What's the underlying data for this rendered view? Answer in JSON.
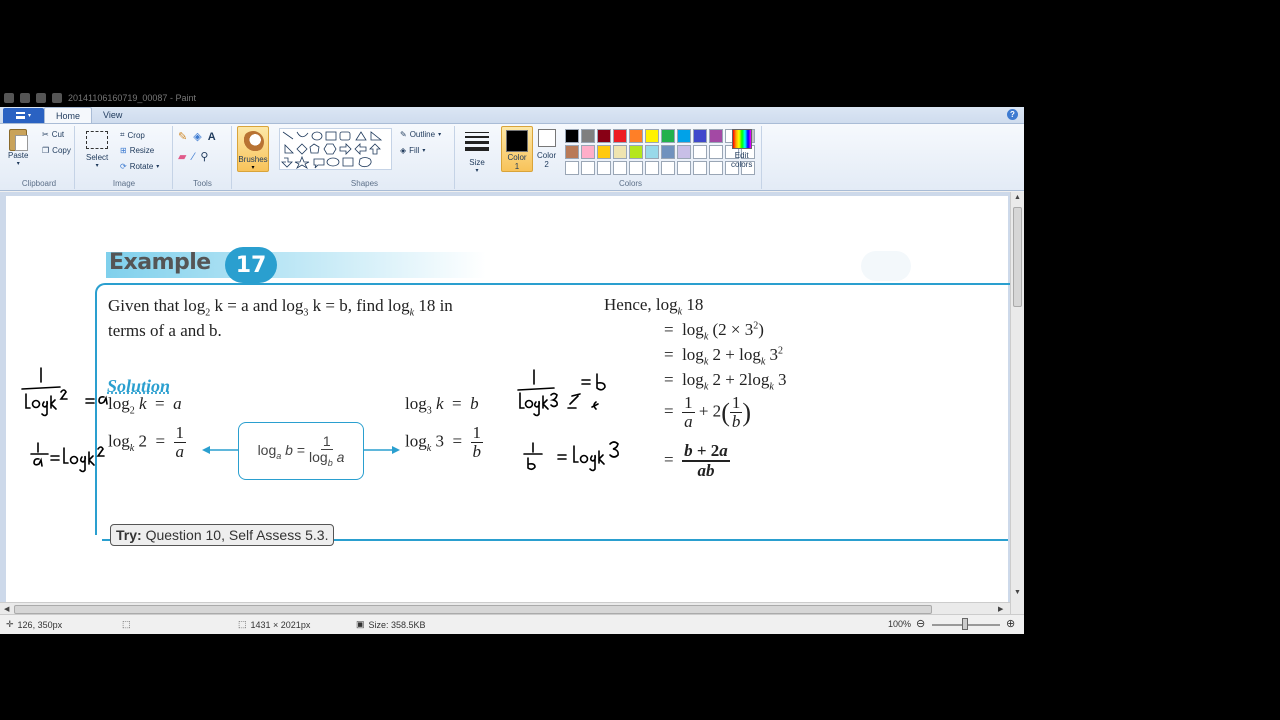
{
  "window": {
    "title": "20141106160719_00087 - Paint"
  },
  "tabs": [
    "Home",
    "View"
  ],
  "ribbon": {
    "clipboard": {
      "paste": "Paste",
      "cut": "Cut",
      "copy": "Copy",
      "label": "Clipboard"
    },
    "image": {
      "select": "Select",
      "crop": "Crop",
      "resize": "Resize",
      "rotate": "Rotate",
      "label": "Image"
    },
    "tools": {
      "label": "Tools"
    },
    "brushes": "Brushes",
    "shapes": {
      "outline": "Outline",
      "fill": "Fill",
      "label": "Shapes"
    },
    "size": "Size",
    "color1": {
      "line1": "Color",
      "line2": "1"
    },
    "color2": {
      "line1": "Color",
      "line2": "2"
    },
    "colors_label": "Colors",
    "edit_colors": {
      "line1": "Edit",
      "line2": "colors"
    },
    "palette": [
      "#000000",
      "#7f7f7f",
      "#880015",
      "#ed1c24",
      "#ff7f27",
      "#fff200",
      "#22b14c",
      "#00a2e8",
      "#3f48cc",
      "#a349a4",
      "#ffffff",
      "#c3c3c3",
      "#b97a57",
      "#ffaec9",
      "#ffc90e",
      "#efe4b0",
      "#b5e61d",
      "#99d9ea",
      "#7092be",
      "#c8bfe7",
      "#ffffff",
      "#ffffff",
      "#ffffff",
      "#ffffff",
      "#ffffff",
      "#ffffff",
      "#ffffff",
      "#ffffff",
      "#ffffff",
      "#ffffff",
      "#ffffff",
      "#ffffff",
      "#ffffff",
      "#ffffff",
      "#ffffff",
      "#ffffff"
    ]
  },
  "document": {
    "example_label": "Example",
    "example_number": "17",
    "question_line1_a": "Given that log",
    "question_line1_b": " k = a and log",
    "question_line1_c": " k = b, find log",
    "question_line1_d": " 18 in",
    "question_line2": "terms of a and b.",
    "solution": "Solution",
    "try_bold": "Try:",
    "try_text": " Question 10, Self Assess 5.3."
  },
  "status": {
    "cursor": "126, 350px",
    "dimensions": "1431 × 2021px",
    "size": "Size: 358.5KB",
    "zoom": "100%"
  },
  "colors": {
    "accent": "#2a9fcf",
    "selected_button": "#f8c35a"
  }
}
